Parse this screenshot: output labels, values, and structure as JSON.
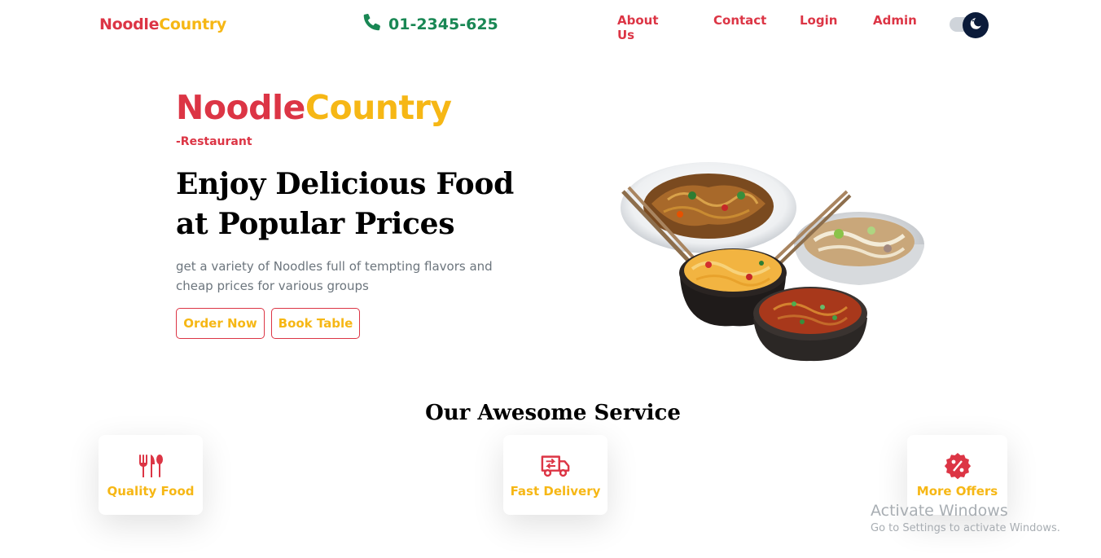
{
  "navbar": {
    "brand_part1": "Noodle",
    "brand_part2": "Country",
    "phone": "01-2345-625",
    "links": {
      "about": "About Us",
      "contact": "Contact",
      "login": "Login",
      "admin": "Admin"
    },
    "theme_toggle_icon": "moon-icon",
    "phone_icon": "phone-icon"
  },
  "hero": {
    "brand_part1": "Noodle",
    "brand_part2": "Country",
    "subtitle": "-Restaurant",
    "title_line1": "Enjoy Delicious Food",
    "title_line2": "at Popular Prices",
    "description": "get a variety of Noodles full of tempting flavors and cheap prices for various groups",
    "order_button": "Order Now",
    "book_button": "Book Table",
    "image": "noodle-bowls-image"
  },
  "services": {
    "title": "Our Awesome Service",
    "items": [
      {
        "label": "Quality Food",
        "icon": "utensils-icon"
      },
      {
        "label": "Fast Delivery",
        "icon": "truck-icon"
      },
      {
        "label": "More Offers",
        "icon": "percent-badge-icon"
      }
    ]
  },
  "watermark": {
    "line1": "Activate Windows",
    "line2": "Go to Settings to activate Windows."
  },
  "colors": {
    "primary_red": "#dc3545",
    "accent_yellow": "#f6b715",
    "phone_green": "#198754",
    "toggle_dark": "#0b1b3a"
  }
}
